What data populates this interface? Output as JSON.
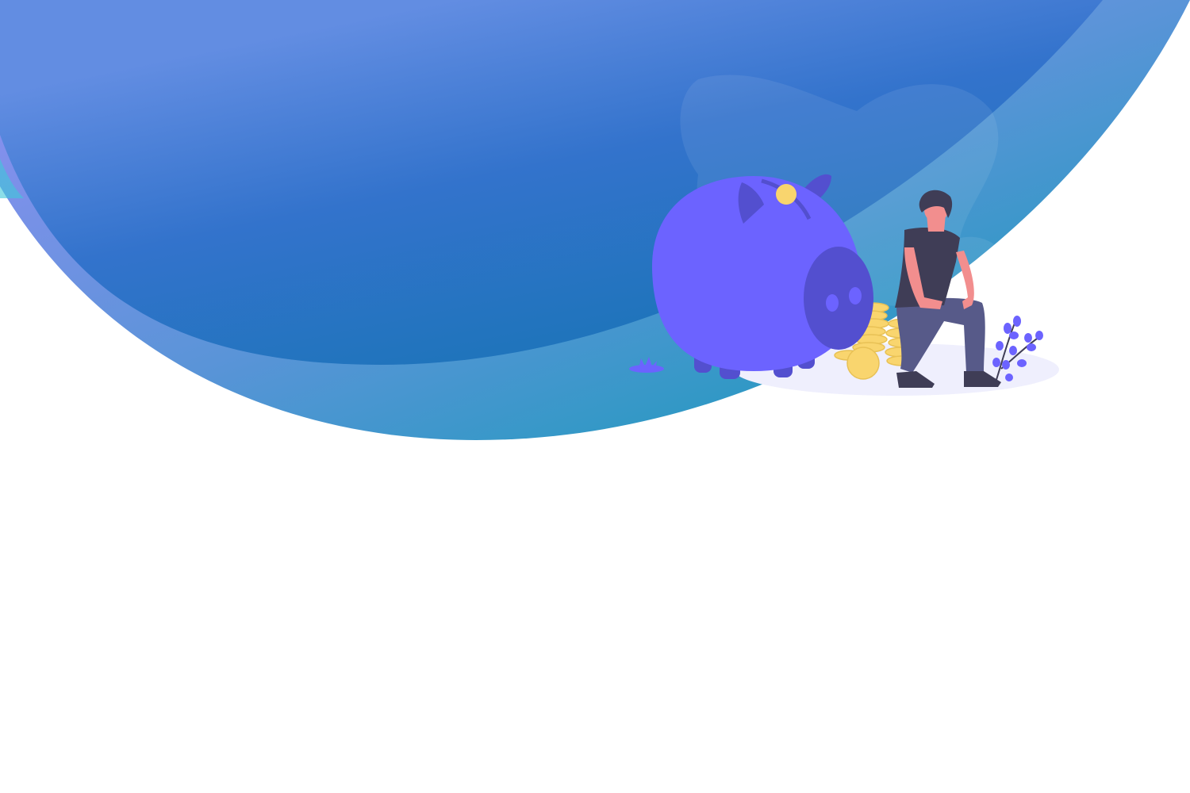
{
  "colors": {
    "outer_gradient_start": "#8a8ff0",
    "outer_gradient_end": "#1b9bbb",
    "inner_gradient_start": "#628de2",
    "inner_gradient_end": "#1b74b8",
    "pig": "#6c63ff",
    "pig_shade": "#534fcf",
    "coin": "#f9d56e",
    "shirt": "#3f3d56",
    "pants": "#575a89",
    "skin": "#f28e8e",
    "shadow": "#efeffd"
  },
  "illustration": {
    "subject": "piggy-bank-savings"
  }
}
